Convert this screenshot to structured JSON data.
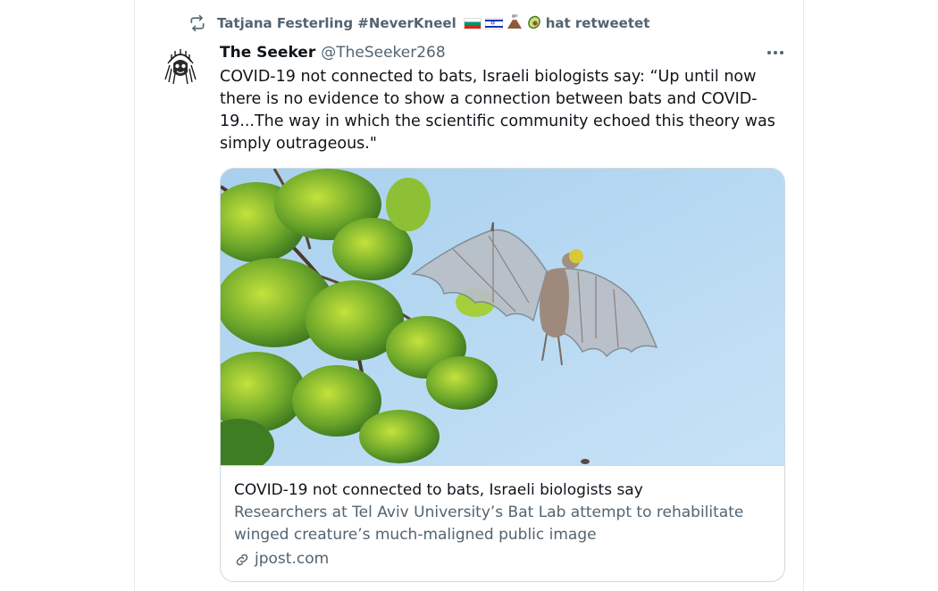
{
  "retweet": {
    "user_name": "Tatjana Festerling #NeverKneel",
    "flags": [
      "flag-bulgaria",
      "flag-israel",
      "volcano-emoji",
      "avocado-emoji"
    ],
    "action": "hat retweetet"
  },
  "tweet": {
    "name": "The Seeker",
    "handle": "@TheSeeker268",
    "text": "COVID-19 not connected to bats, Israeli biologists say: “Up until now there is no evidence to show a connection between bats and COVID-19...The way in which the scientific community echoed this theory was simply outrageous.\"",
    "more_icon": "more-horizontal-icon"
  },
  "card": {
    "image_alt": "fruit bat flying near green leaves against blue sky",
    "title": "COVID-19 not connected to bats, Israeli biologists say",
    "description": "Researchers at Tel Aviv University’s Bat Lab attempt to rehabilitate winged creature’s much-maligned public image",
    "domain": "jpost.com",
    "domain_icon": "link-icon"
  },
  "colors": {
    "text_primary": "#0f1419",
    "text_secondary": "#536471",
    "border": "#cfd9de",
    "sky": "#b8d9f0"
  }
}
